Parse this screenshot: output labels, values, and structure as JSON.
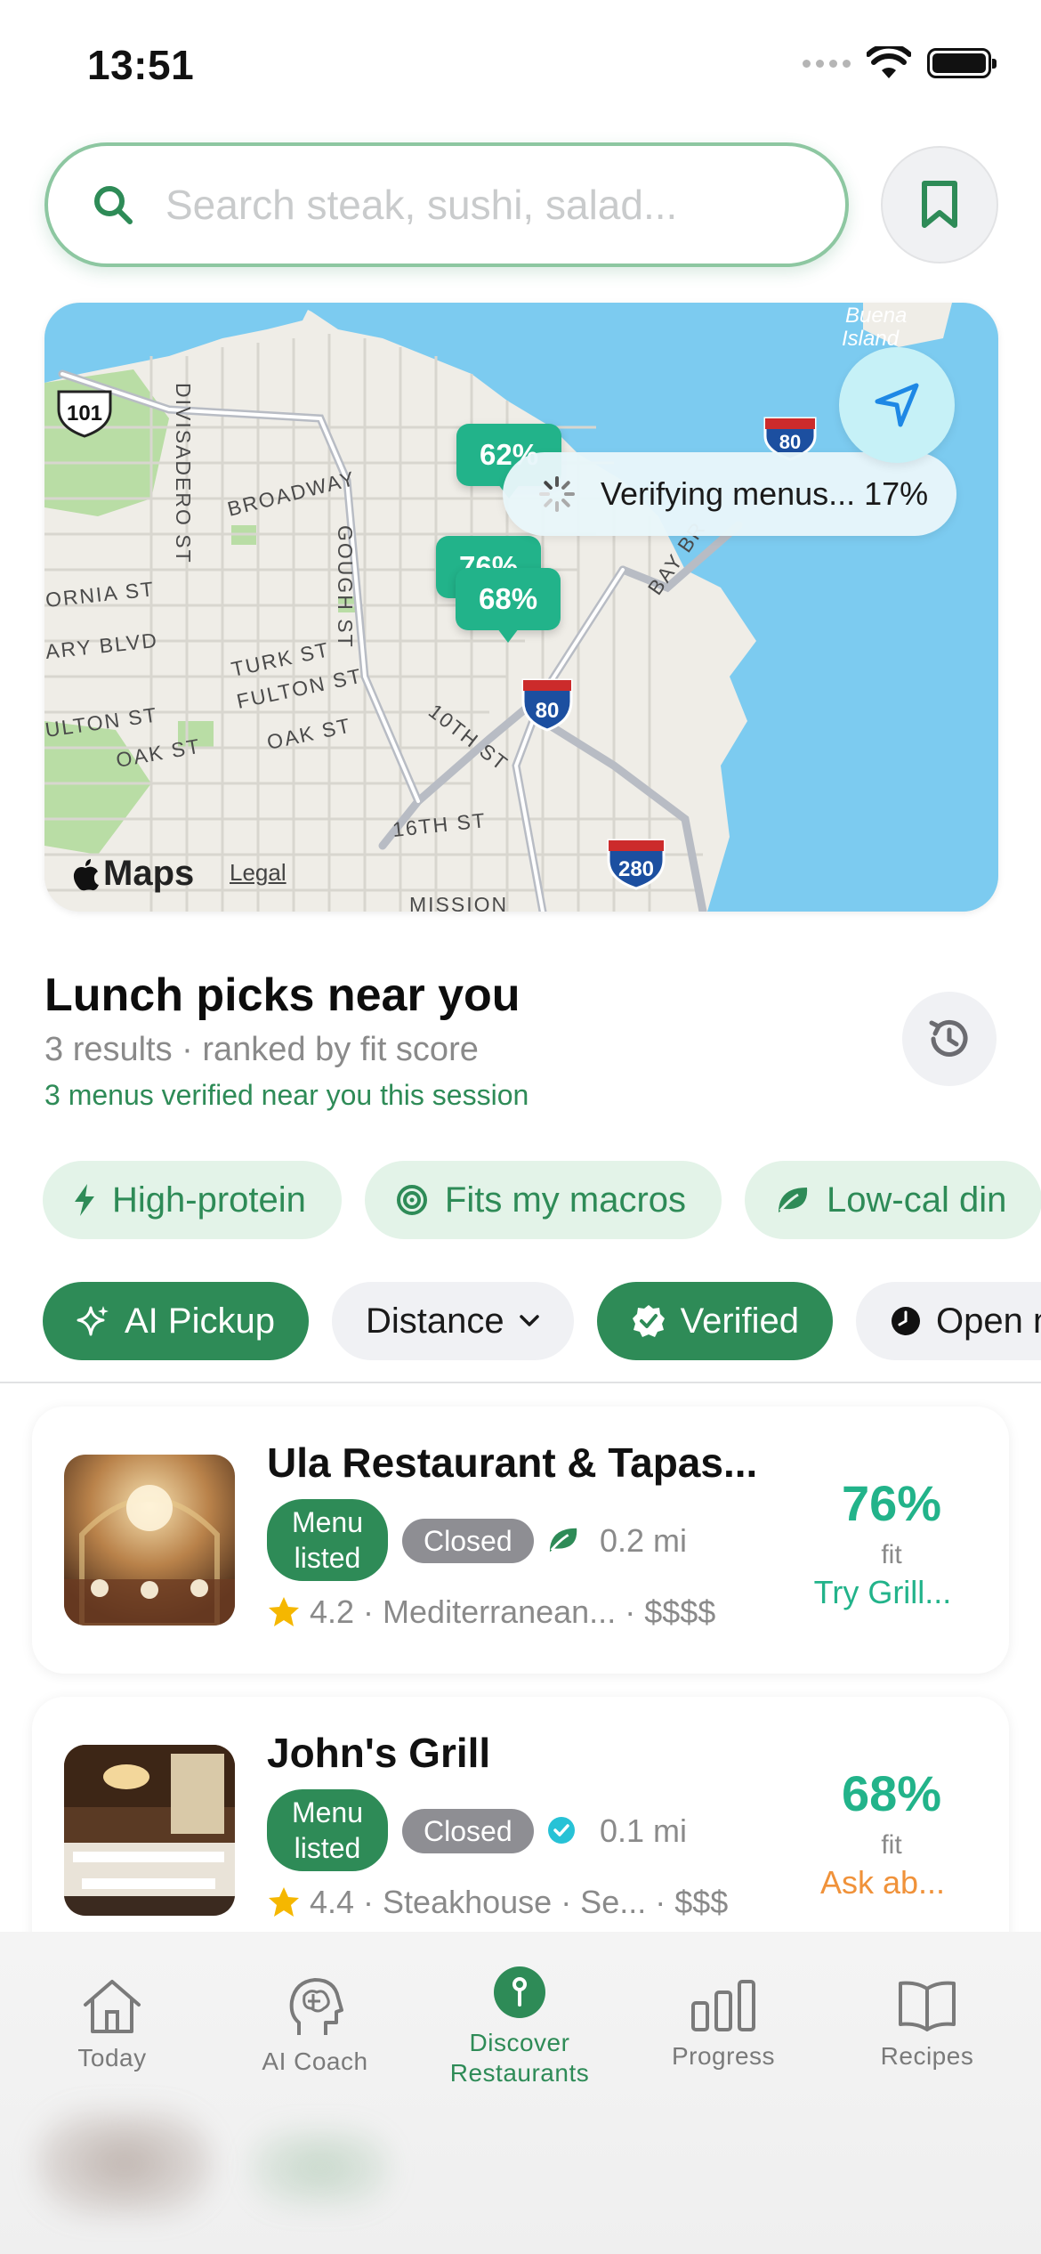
{
  "status_bar": {
    "time": "13:51"
  },
  "search": {
    "placeholder": "Search steak, sushi, salad..."
  },
  "map": {
    "verify_status": "Verifying menus... 17%",
    "pins": [
      "62%",
      "76%",
      "68%"
    ],
    "attribution": "Maps",
    "legal": "Legal",
    "road_labels": [
      "101",
      "DIVISADERO ST",
      "BROADWAY",
      "GOUGH ST",
      "ORNIA ST",
      "ARY BLVD",
      "TURK ST",
      "FULTON ST",
      "ULTON ST",
      "OAK ST",
      "OAK ST",
      "10TH ST",
      "16TH ST",
      "BAY BR",
      "80",
      "80",
      "280",
      "Buena",
      "Island",
      "MISSION"
    ]
  },
  "section": {
    "title": "Lunch picks near you",
    "subtitle": "3 results · ranked by fit score",
    "verified_note": "3 menus verified near you this session"
  },
  "goal_chips": [
    "High-protein",
    "Fits my macros",
    "Low-cal din"
  ],
  "filters": [
    {
      "label": "AI Pickup",
      "active": true
    },
    {
      "label": "Distance",
      "active": false
    },
    {
      "label": "Verified",
      "active": true
    },
    {
      "label": "Open n",
      "active": false
    }
  ],
  "results": [
    {
      "name": "Ula Restaurant & Tapas...",
      "menu_badge_line1": "Menu",
      "menu_badge_line2": "listed",
      "status": "Closed",
      "badge_icon": "leaf-icon",
      "distance": "0.2 mi",
      "rating": "4.2",
      "cuisine": "Mediterranean...",
      "price": "$$$$",
      "fit_percent": "76%",
      "fit_label": "fit",
      "fit_action": "Try Grill...",
      "fit_action_color": "#22b38a"
    },
    {
      "name": "John's Grill",
      "menu_badge_line1": "Menu",
      "menu_badge_line2": "listed",
      "status": "Closed",
      "badge_icon": "verified-check-icon",
      "distance": "0.1 mi",
      "rating": "4.4",
      "cuisine": "Steakhouse · Se...",
      "price": "$$$",
      "fit_percent": "68%",
      "fit_label": "fit",
      "fit_action": "Ask ab...",
      "fit_action_color": "#f0923a"
    }
  ],
  "tabs": [
    {
      "label": "Today",
      "icon": "house-icon"
    },
    {
      "label": "AI Coach",
      "icon": "brain-head-icon"
    },
    {
      "label": "Discover Restaurants",
      "line1": "Discover",
      "line2": "Restaurants",
      "icon": "map-pin-icon",
      "active": true
    },
    {
      "label": "Progress",
      "icon": "bar-chart-icon"
    },
    {
      "label": "Recipes",
      "icon": "book-icon"
    }
  ],
  "colors": {
    "brand_green": "#2e8b57",
    "fit_teal": "#22b38a",
    "warning_orange": "#f0923a",
    "water": "#7ccbf0"
  }
}
